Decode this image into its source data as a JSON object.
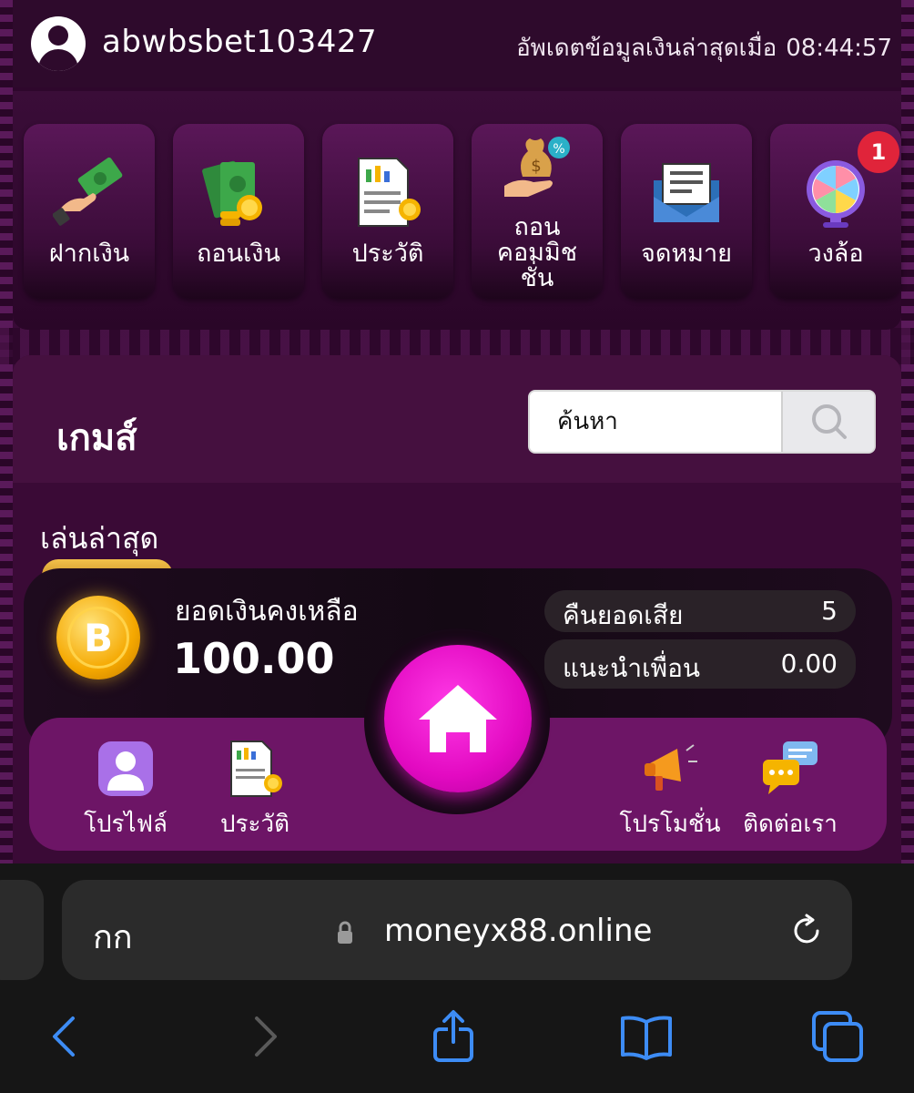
{
  "header": {
    "username": "abwbsbet103427",
    "update_label": "อัพเดตข้อมูลเงินล่าสุดเมื่อ",
    "update_time": "08:44:57"
  },
  "menu": {
    "items": [
      {
        "label": "ฝากเงิน",
        "icon": "deposit-money-icon"
      },
      {
        "label": "ถอนเงิน",
        "icon": "withdraw-money-icon"
      },
      {
        "label": "ประวัติ",
        "icon": "history-report-icon"
      },
      {
        "label": "ถอน\nคอมมิช\nชั่น",
        "icon": "commission-withdraw-icon"
      },
      {
        "label": "จดหมาย",
        "icon": "mail-envelope-icon"
      },
      {
        "label": "วงล้อ",
        "icon": "prize-wheel-icon",
        "badge": "1"
      }
    ]
  },
  "games": {
    "title": "เกมส์",
    "search_placeholder": "ค้นหา",
    "recent_label": "เล่นล่าสุด"
  },
  "balance": {
    "label": "ยอดเงินคงเหลือ",
    "value": "100.00",
    "stats": [
      {
        "label": "คืนยอดเสีย",
        "value": "5"
      },
      {
        "label": "แนะนำเพื่อน",
        "value": "0.00"
      }
    ]
  },
  "bottom_nav": {
    "items": [
      {
        "label": "โปรไฟล์",
        "icon": "profile-icon"
      },
      {
        "label": "ประวัติ",
        "icon": "history-icon"
      },
      {
        "label": "โปรโมชั่น",
        "icon": "megaphone-icon"
      },
      {
        "label": "ติดต่อเรา",
        "icon": "chat-bubbles-icon"
      }
    ],
    "home_icon": "home-icon"
  },
  "browser": {
    "aa_label": "กก",
    "url": "moneyx88.online"
  },
  "colors": {
    "accent": "#e30ac2",
    "nav_bg": "#6d1566",
    "badge": "#e0243a"
  }
}
